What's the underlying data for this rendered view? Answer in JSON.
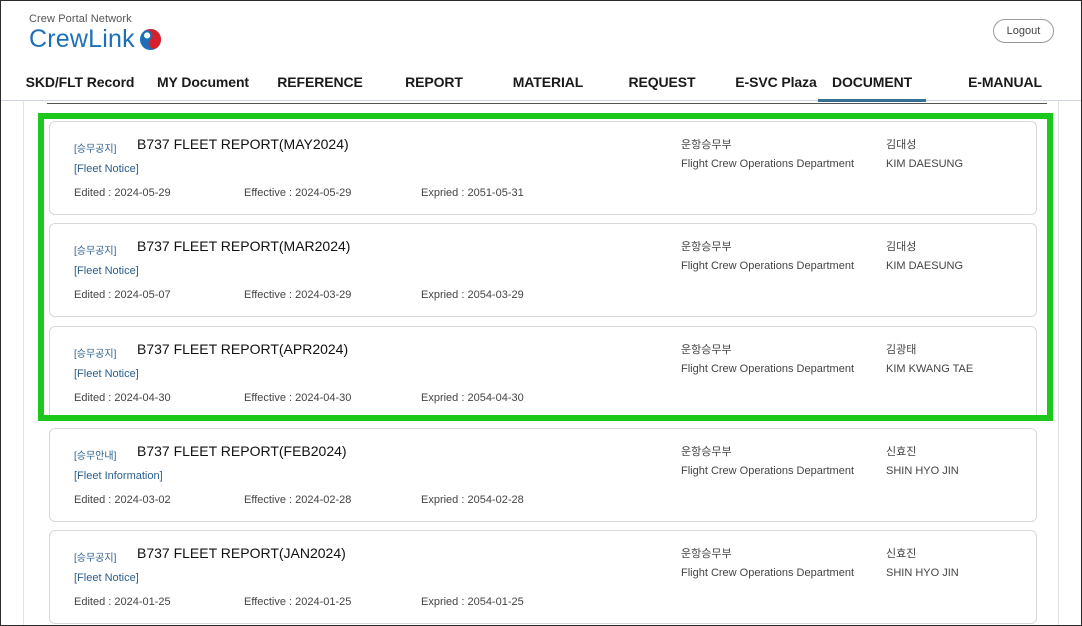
{
  "header": {
    "logo_sub": "Crew Portal Network",
    "logo_text": "CrewLink",
    "logout_label": "Logout"
  },
  "nav": {
    "items": [
      {
        "label": "SKD/FLT Record"
      },
      {
        "label": "MY Document"
      },
      {
        "label": "REFERENCE"
      },
      {
        "label": "REPORT"
      },
      {
        "label": "MATERIAL"
      },
      {
        "label": "REQUEST"
      },
      {
        "label": "E-SVC Plaza"
      },
      {
        "label": "DOCUMENT",
        "active": true
      },
      {
        "label": "E-MANUAL"
      }
    ]
  },
  "documents": [
    {
      "tag": "[승무공지]",
      "title": "B737 FLEET REPORT(MAY2024)",
      "category": "[Fleet Notice]",
      "edited": "Edited : 2024-05-29",
      "effective": "Effective : 2024-05-29",
      "expired": "Expried : 2051-05-31",
      "dept_ko": "운항승무부",
      "dept_en": "Flight Crew Operations Department",
      "name_ko": "김대성",
      "name_en": "KIM DAESUNG"
    },
    {
      "tag": "[승무공지]",
      "title": "B737 FLEET REPORT(MAR2024)",
      "category": "[Fleet Notice]",
      "edited": "Edited : 2024-05-07",
      "effective": "Effective : 2024-03-29",
      "expired": "Expried : 2054-03-29",
      "dept_ko": "운항승무부",
      "dept_en": "Flight Crew Operations Department",
      "name_ko": "김대성",
      "name_en": "KIM DAESUNG"
    },
    {
      "tag": "[승무공지]",
      "title": "B737 FLEET REPORT(APR2024)",
      "category": "[Fleet Notice]",
      "edited": "Edited : 2024-04-30",
      "effective": "Effective : 2024-04-30",
      "expired": "Expried : 2054-04-30",
      "dept_ko": "운항승무부",
      "dept_en": "Flight Crew Operations Department",
      "name_ko": "김광태",
      "name_en": "KIM KWANG TAE"
    },
    {
      "tag": "[승무안내]",
      "title": "B737 FLEET REPORT(FEB2024)",
      "category": "[Fleet Information]",
      "edited": "Edited : 2024-03-02",
      "effective": "Effective : 2024-02-28",
      "expired": "Expried : 2054-02-28",
      "dept_ko": "운항승무부",
      "dept_en": "Flight Crew Operations Department",
      "name_ko": "신효진",
      "name_en": "SHIN HYO JIN"
    },
    {
      "tag": "[승무공지]",
      "title": "B737 FLEET REPORT(JAN2024)",
      "category": "[Fleet Notice]",
      "edited": "Edited : 2024-01-25",
      "effective": "Effective : 2024-01-25",
      "expired": "Expried : 2054-01-25",
      "dept_ko": "운항승무부",
      "dept_en": "Flight Crew Operations Department",
      "name_ko": "신효진",
      "name_en": "SHIN HYO JIN"
    }
  ],
  "colors": {
    "brand_blue": "#1d6fb8",
    "emblem_red": "#d6212c",
    "link_blue": "#2a5e8c",
    "highlight_green": "#1cc81c"
  }
}
